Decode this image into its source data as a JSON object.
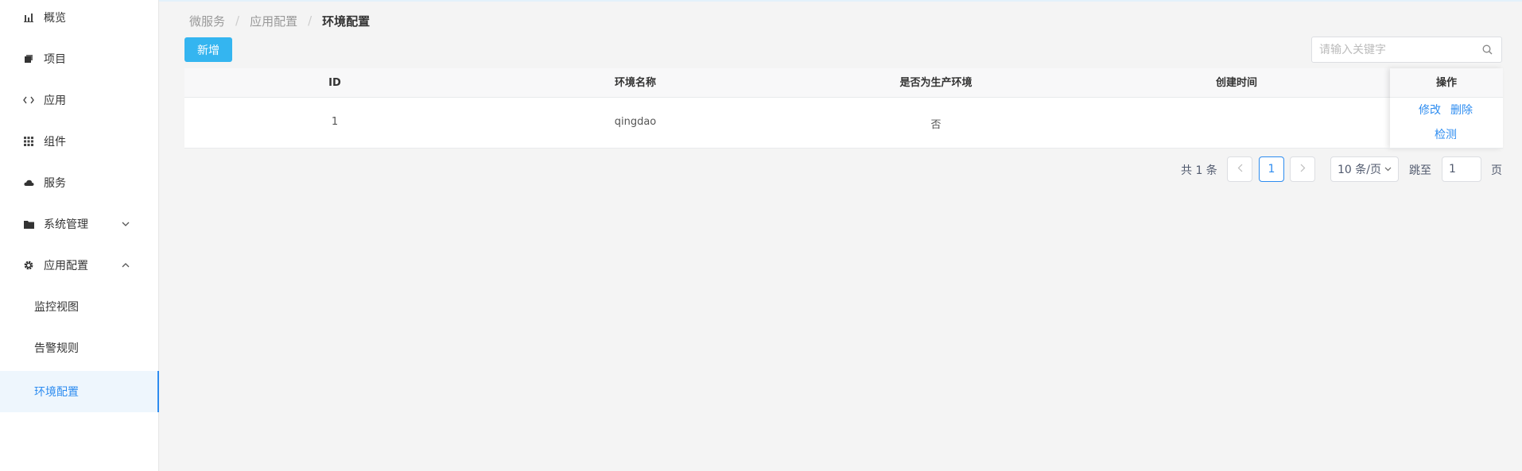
{
  "sidebar": {
    "items": [
      {
        "label": "概览",
        "icon": "bar-chart-icon"
      },
      {
        "label": "项目",
        "icon": "stack-icon"
      },
      {
        "label": "应用",
        "icon": "code-icon"
      },
      {
        "label": "组件",
        "icon": "grid-icon"
      },
      {
        "label": "服务",
        "icon": "cloud-icon"
      },
      {
        "label": "系统管理",
        "icon": "folder-icon",
        "expanded": false
      },
      {
        "label": "应用配置",
        "icon": "gear-icon",
        "expanded": true
      }
    ],
    "subitems": [
      {
        "label": "监控视图",
        "active": false
      },
      {
        "label": "告警规则",
        "active": false
      },
      {
        "label": "环境配置",
        "active": true
      }
    ],
    "active_color": "#2d8cf0"
  },
  "breadcrumb": [
    "微服务",
    "应用配置",
    "环境配置"
  ],
  "toolbar": {
    "add_label": "新增",
    "add_color": "#34b5f0"
  },
  "search": {
    "placeholder": "请输入关键字",
    "value": ""
  },
  "table": {
    "columns": [
      "ID",
      "环境名称",
      "是否为生产环境",
      "创建时间",
      "操作"
    ],
    "rows": [
      {
        "id": "1",
        "name": "qingdao",
        "is_production": "否",
        "created": "",
        "actions": [
          "修改",
          "删除",
          "检测"
        ]
      }
    ]
  },
  "pagination": {
    "total_text": "共 1 条",
    "current_page": "1",
    "page_size": "10 条/页",
    "jump_label": "跳至",
    "jump_value": "1",
    "page_suffix": "页"
  }
}
